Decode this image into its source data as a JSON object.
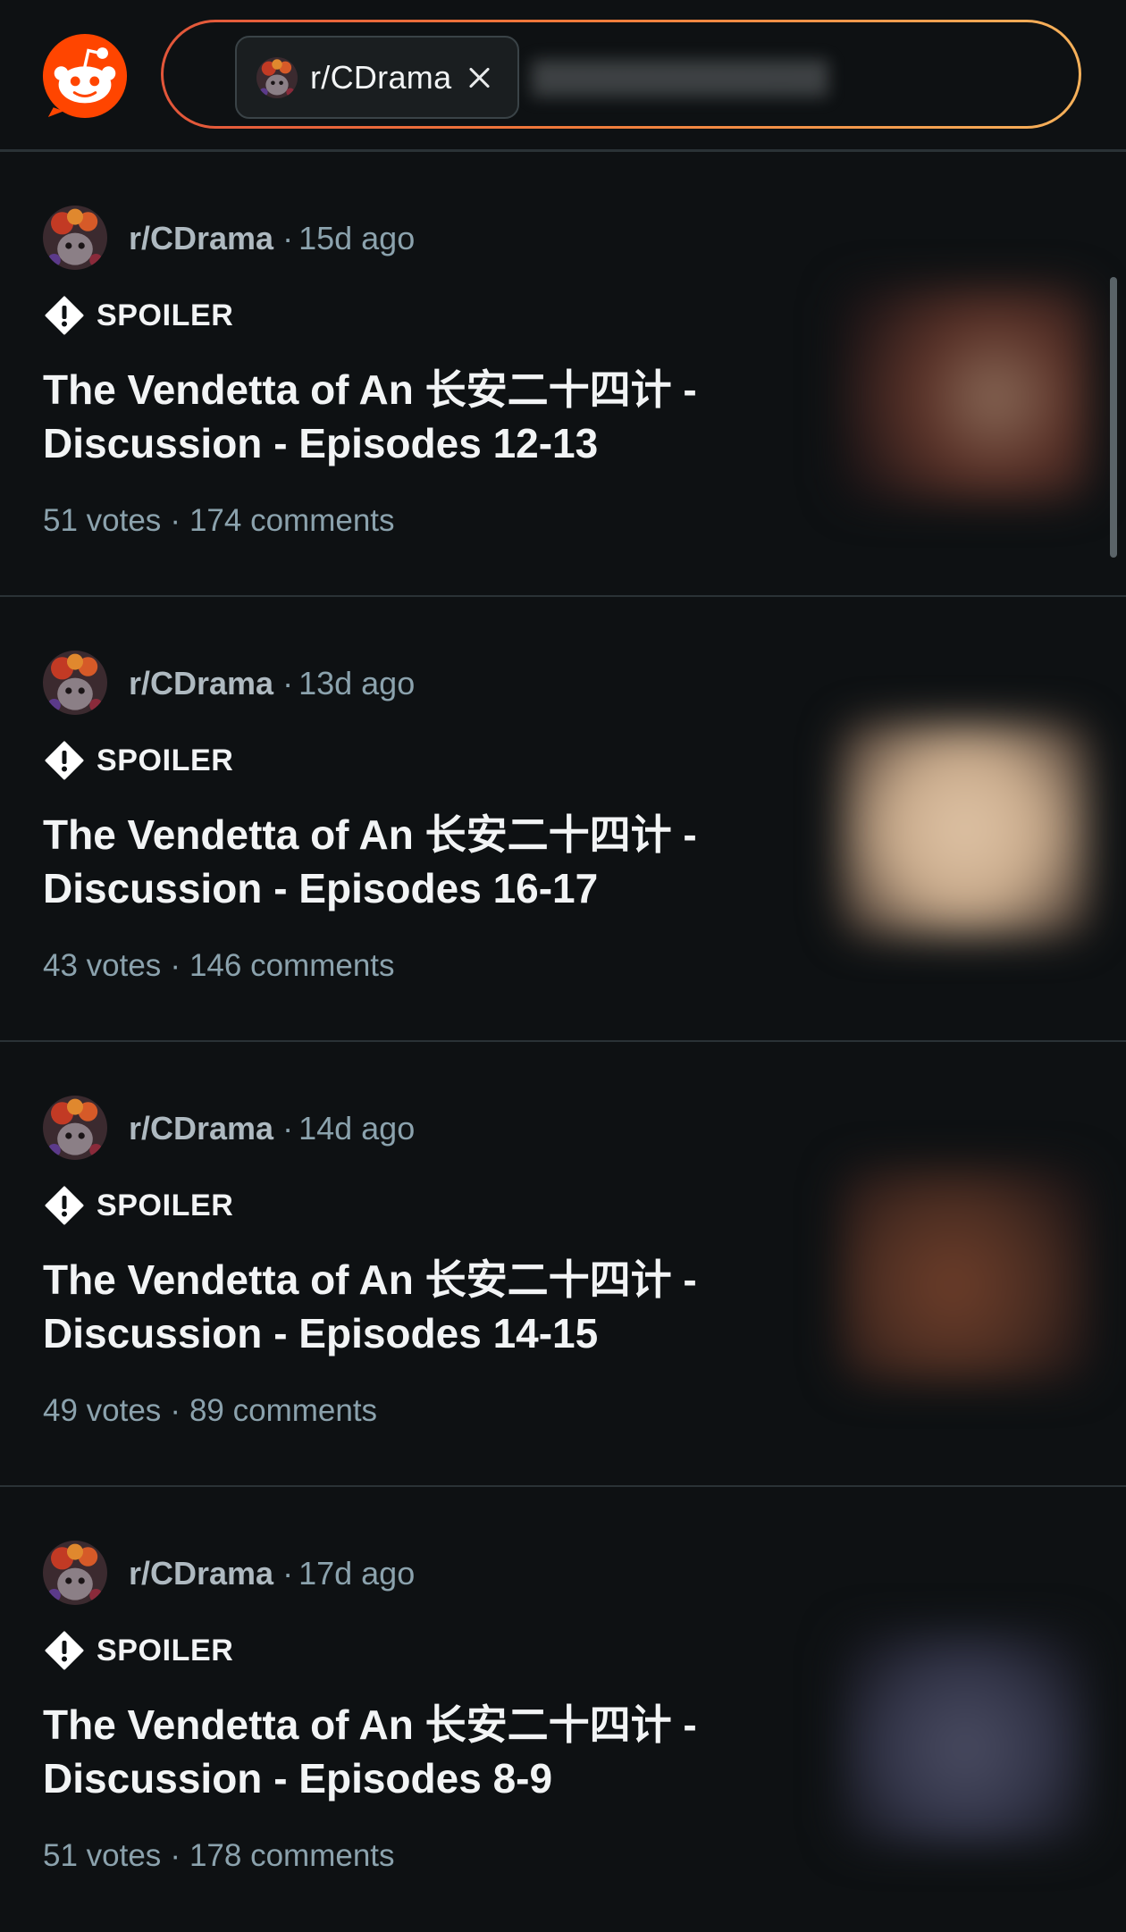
{
  "header": {
    "community_chip": {
      "label": "r/CDrama",
      "avatar_icon": "subreddit-avatar-icon",
      "close_icon": "close-icon"
    },
    "search_gradient": [
      "#e2563a",
      "#f6b15a"
    ]
  },
  "colors": {
    "background": "#0e1113",
    "divider": "#2a3236",
    "brand_orange": "#ff4500",
    "meta_text": "#8ba2ad",
    "title_text": "#f2f4f5"
  },
  "feed": {
    "posts": [
      {
        "subreddit": "r/CDrama",
        "dot": "·",
        "time": "15d ago",
        "flair": "SPOILER",
        "title_line1": "The Vendetta of An 长安二十四计 -",
        "title_line2": "Discussion - Episodes 12-13",
        "votes": "51 votes",
        "stats_dot": "·",
        "comments": "174 comments",
        "thumbnail_color": "#5a3228"
      },
      {
        "subreddit": "r/CDrama",
        "dot": "·",
        "time": "13d ago",
        "flair": "SPOILER",
        "title_line1": "The Vendetta of An 长安二十四计 -",
        "title_line2": "Discussion - Episodes 16-17",
        "votes": "43 votes",
        "stats_dot": "·",
        "comments": "146 comments",
        "thumbnail_color": "#c9ab8c"
      },
      {
        "subreddit": "r/CDrama",
        "dot": "·",
        "time": "14d ago",
        "flair": "SPOILER",
        "title_line1": "The Vendetta of An 长安二十四计 -",
        "title_line2": "Discussion - Episodes 14-15",
        "votes": "49 votes",
        "stats_dot": "·",
        "comments": "89 comments",
        "thumbnail_color": "#4d2e22"
      },
      {
        "subreddit": "r/CDrama",
        "dot": "·",
        "time": "17d ago",
        "flair": "SPOILER",
        "title_line1": "The Vendetta of An 长安二十四计 -",
        "title_line2": "Discussion - Episodes 8-9",
        "votes": "51 votes",
        "stats_dot": "·",
        "comments": "178 comments",
        "thumbnail_color": "#34364a"
      }
    ]
  }
}
